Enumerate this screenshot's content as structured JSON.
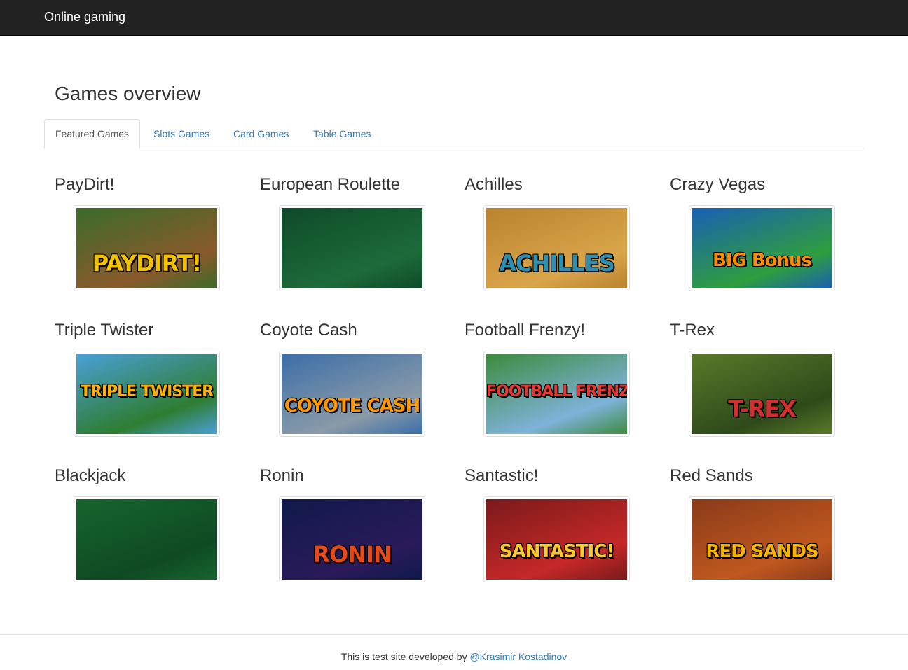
{
  "navbar": {
    "brand": "Online gaming"
  },
  "page": {
    "title": "Games overview"
  },
  "tabs": [
    {
      "label": "Featured Games",
      "active": true
    },
    {
      "label": "Slots Games",
      "active": false
    },
    {
      "label": "Card Games",
      "active": false
    },
    {
      "label": "Table Games",
      "active": false
    }
  ],
  "games": [
    {
      "title": "PayDirt!",
      "art_text": "PAYDIRT!",
      "colors": [
        "#3a6b2a",
        "#8a5a2b",
        "#f2c200"
      ]
    },
    {
      "title": "European Roulette",
      "art_text": "",
      "colors": [
        "#0f4a2a",
        "#1d6b3a",
        "#b22222"
      ]
    },
    {
      "title": "Achilles",
      "art_text": "ACHILLES",
      "colors": [
        "#b9822f",
        "#d9a54a",
        "#2f8fb0"
      ]
    },
    {
      "title": "Crazy Vegas",
      "art_text": "BIG Bonus",
      "colors": [
        "#1a5fb4",
        "#2e9e3e",
        "#ff8c00"
      ]
    },
    {
      "title": "Triple Twister",
      "art_text": "TRIPLE TWISTER",
      "colors": [
        "#4aa0d8",
        "#2e7d32",
        "#ffb300"
      ]
    },
    {
      "title": "Coyote Cash",
      "art_text": "COYOTE CASH",
      "colors": [
        "#3b6ea8",
        "#8a9aa8",
        "#ff9800"
      ]
    },
    {
      "title": "Football Frenzy!",
      "art_text": "FOOTBALL FRENZY!",
      "colors": [
        "#3d8a3d",
        "#7fb2d9",
        "#e53935"
      ]
    },
    {
      "title": "T-Rex",
      "art_text": "T-REX",
      "colors": [
        "#5a7a2a",
        "#2e4a1a",
        "#d32f2f"
      ]
    },
    {
      "title": "Blackjack",
      "art_text": "",
      "colors": [
        "#17652e",
        "#0f4a22",
        "#ffffff"
      ]
    },
    {
      "title": "Ronin",
      "art_text": "RONIN",
      "colors": [
        "#101a4a",
        "#2a1a5a",
        "#e64a19"
      ]
    },
    {
      "title": "Santastic!",
      "art_text": "SANTASTIC!",
      "colors": [
        "#7a1a1a",
        "#c62828",
        "#ffca28"
      ]
    },
    {
      "title": "Red Sands",
      "art_text": "RED SANDS",
      "colors": [
        "#8a3a1a",
        "#c0581f",
        "#f4b400"
      ]
    }
  ],
  "footer": {
    "text": "This is test site developed by ",
    "link": "@Krasimir Kostadinov"
  }
}
